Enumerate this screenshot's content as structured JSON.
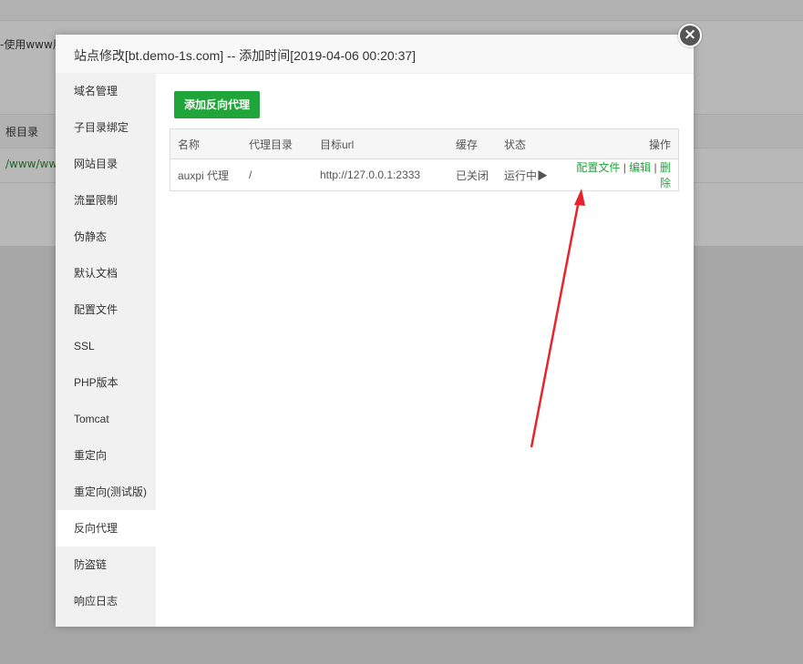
{
  "background": {
    "www_text": "-使用www用",
    "root_col": "根目录",
    "path_text": "/www/www"
  },
  "modal": {
    "title": "站点修改[bt.demo-1s.com] -- 添加时间[2019-04-06 00:20:37]",
    "close_symbol": "×"
  },
  "sidebar": {
    "items": [
      {
        "label": "域名管理"
      },
      {
        "label": "子目录绑定"
      },
      {
        "label": "网站目录"
      },
      {
        "label": "流量限制"
      },
      {
        "label": "伪静态"
      },
      {
        "label": "默认文档"
      },
      {
        "label": "配置文件"
      },
      {
        "label": "SSL"
      },
      {
        "label": "PHP版本"
      },
      {
        "label": "Tomcat"
      },
      {
        "label": "重定向"
      },
      {
        "label": "重定向(测试版)"
      },
      {
        "label": "反向代理"
      },
      {
        "label": "防盗链"
      },
      {
        "label": "响应日志"
      }
    ],
    "active_index": 12
  },
  "proxy": {
    "add_button": "添加反向代理",
    "columns": [
      "名称",
      "代理目录",
      "目标url",
      "缓存",
      "状态",
      "操作"
    ],
    "rows": [
      {
        "name": "auxpi 代理",
        "dir": "/",
        "url": "http://127.0.0.1:2333",
        "cache": "已关闭",
        "status": "运行中",
        "status_icon": "play-icon",
        "actions": [
          "配置文件",
          "编辑",
          "删除"
        ]
      }
    ]
  },
  "colors": {
    "accent_green": "#20a53a",
    "alert_red": "#e00000",
    "arrow_red": "#e8232b"
  }
}
